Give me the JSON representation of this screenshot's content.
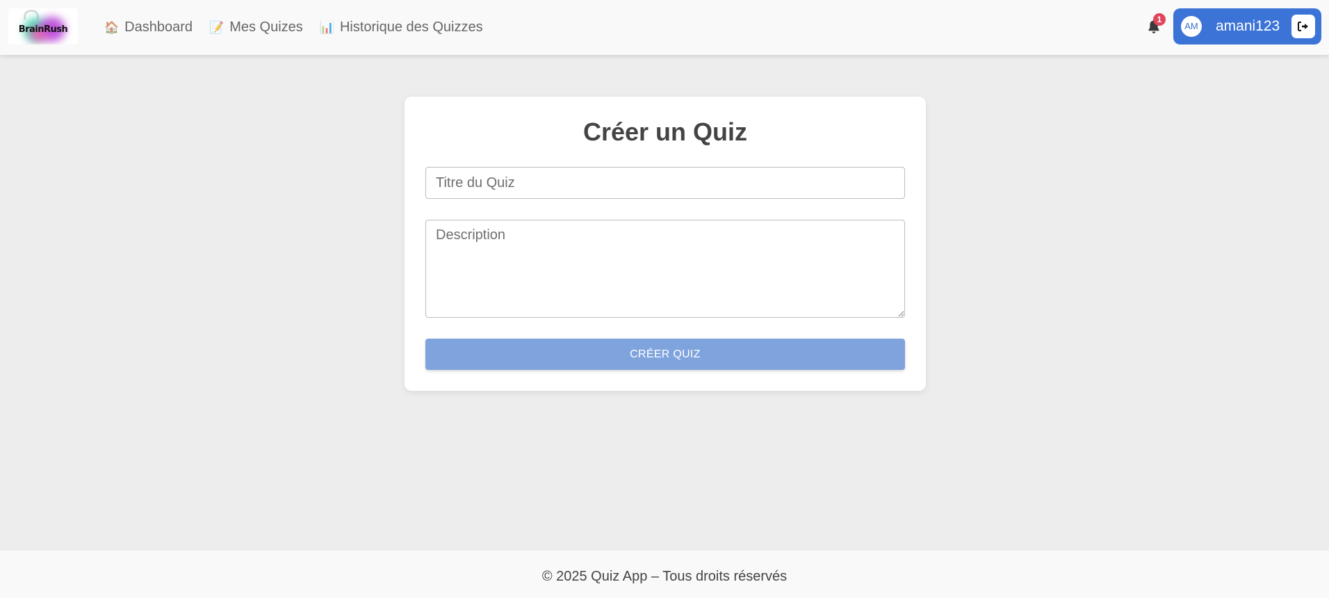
{
  "brand": {
    "logo_text": "BrainRush"
  },
  "nav": {
    "items": [
      {
        "label": "Dashboard",
        "icon": "house-icon",
        "glyph": "🏠"
      },
      {
        "label": "Mes Quizes",
        "icon": "memo-icon",
        "glyph": "📝"
      },
      {
        "label": "Historique des Quizzes",
        "icon": "bar-chart-icon",
        "glyph": "📊"
      }
    ]
  },
  "notifications": {
    "count": "1",
    "icon": "bell-icon"
  },
  "user": {
    "initials": "AM",
    "username": "amani123",
    "logout_icon": "sign-out-icon"
  },
  "form": {
    "title": "Créer un Quiz",
    "title_placeholder": "Titre du Quiz",
    "title_value": "",
    "description_placeholder": "Description",
    "description_value": "",
    "submit_label": "CRÉER QUIZ"
  },
  "footer": {
    "text": "© 2025 Quiz App – Tous droits réservés"
  },
  "colors": {
    "accent": "#3b73d6",
    "submit_button": "#7fa3dd",
    "badge": "#e0455a",
    "background": "#ededed"
  }
}
